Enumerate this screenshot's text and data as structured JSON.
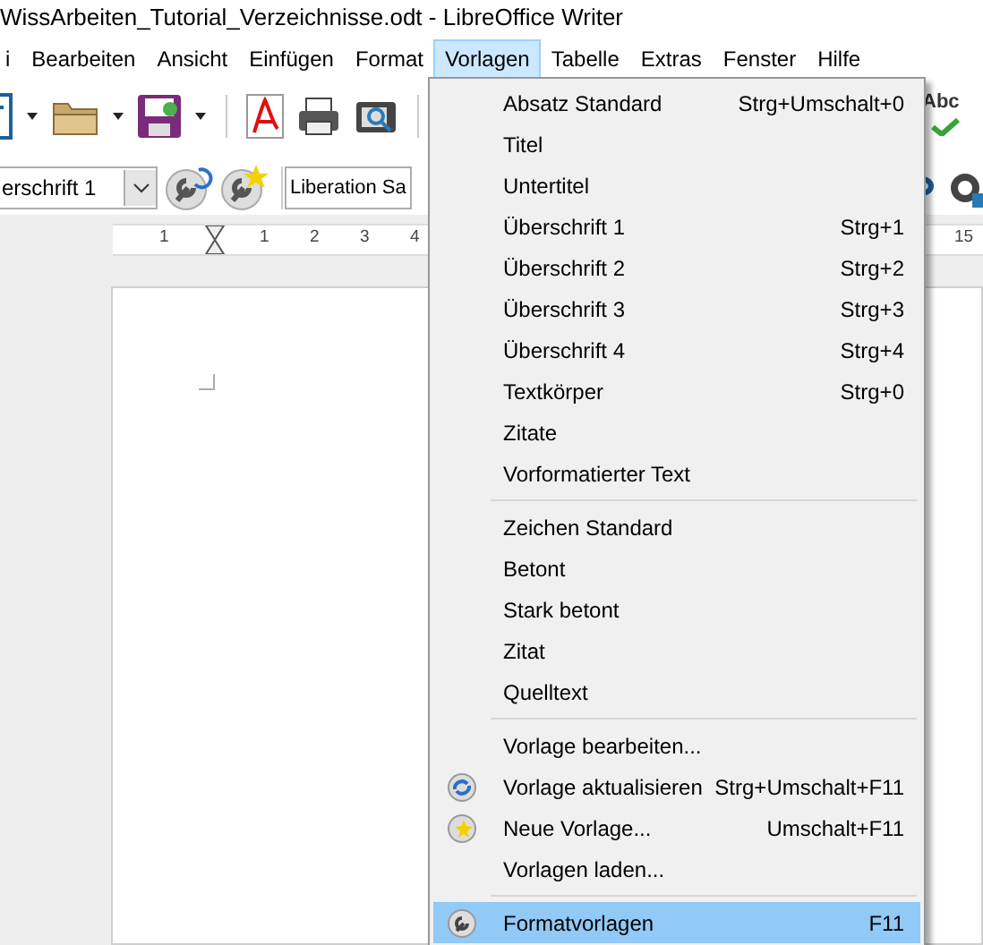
{
  "window": {
    "title": "WissArbeiten_Tutorial_Verzeichnisse.odt - LibreOffice Writer"
  },
  "menubar": [
    {
      "label": "i",
      "selected": false
    },
    {
      "label": "Bearbeiten",
      "selected": false
    },
    {
      "label": "Ansicht",
      "selected": false
    },
    {
      "label": "Einfügen",
      "selected": false
    },
    {
      "label": "Format",
      "selected": false
    },
    {
      "label": "Vorlagen",
      "selected": true
    },
    {
      "label": "Tabelle",
      "selected": false
    },
    {
      "label": "Extras",
      "selected": false
    },
    {
      "label": "Fenster",
      "selected": false
    },
    {
      "label": "Hilfe",
      "selected": false
    }
  ],
  "format_bar": {
    "paragraph_style": "erschrift 1",
    "font_name": "Liberation Sa",
    "spellcheck_label": "Abc"
  },
  "ruler": {
    "labels": [
      "1",
      "1",
      "2",
      "3",
      "4",
      "15"
    ]
  },
  "menu": {
    "sections": [
      [
        {
          "label": "Absatz Standard",
          "shortcut": "Strg+Umschalt+0",
          "kind": "plain",
          "selected": false
        },
        {
          "label": "Titel",
          "kind": "plain",
          "selected": false
        },
        {
          "label": "Untertitel",
          "kind": "plain",
          "selected": false
        },
        {
          "label": "Überschrift 1",
          "shortcut": "Strg+1",
          "kind": "plain",
          "selected": false
        },
        {
          "label": "Überschrift 2",
          "shortcut": "Strg+2",
          "kind": "plain",
          "selected": false
        },
        {
          "label": "Überschrift 3",
          "shortcut": "Strg+3",
          "kind": "plain",
          "selected": false
        },
        {
          "label": "Überschrift 4",
          "shortcut": "Strg+4",
          "kind": "plain",
          "selected": false
        },
        {
          "label": "Textkörper",
          "shortcut": "Strg+0",
          "kind": "plain",
          "selected": false
        },
        {
          "label": "Zitate",
          "kind": "plain",
          "selected": false
        },
        {
          "label": "Vorformatierter Text",
          "kind": "plain",
          "selected": false
        }
      ],
      [
        {
          "label": "Zeichen Standard",
          "kind": "plain",
          "selected": false
        },
        {
          "label": "Betont",
          "kind": "plain",
          "selected": false
        },
        {
          "label": "Stark betont",
          "kind": "plain",
          "selected": false
        },
        {
          "label": "Zitat",
          "kind": "plain",
          "selected": false
        },
        {
          "label": "Quelltext",
          "kind": "plain",
          "selected": false
        }
      ],
      [
        {
          "label": "Vorlage bearbeiten...",
          "kind": "plain",
          "selected": false
        },
        {
          "label": "Vorlage aktualisieren",
          "shortcut": "Strg+Umschalt+F11",
          "kind": "update",
          "selected": false
        },
        {
          "label": "Neue Vorlage...",
          "shortcut": "Umschalt+F11",
          "kind": "new",
          "selected": false
        },
        {
          "label": "Vorlagen laden...",
          "kind": "plain",
          "selected": false
        }
      ],
      [
        {
          "label": "Formatvorlagen",
          "shortcut": "F11",
          "kind": "styles",
          "selected": true
        }
      ]
    ]
  }
}
